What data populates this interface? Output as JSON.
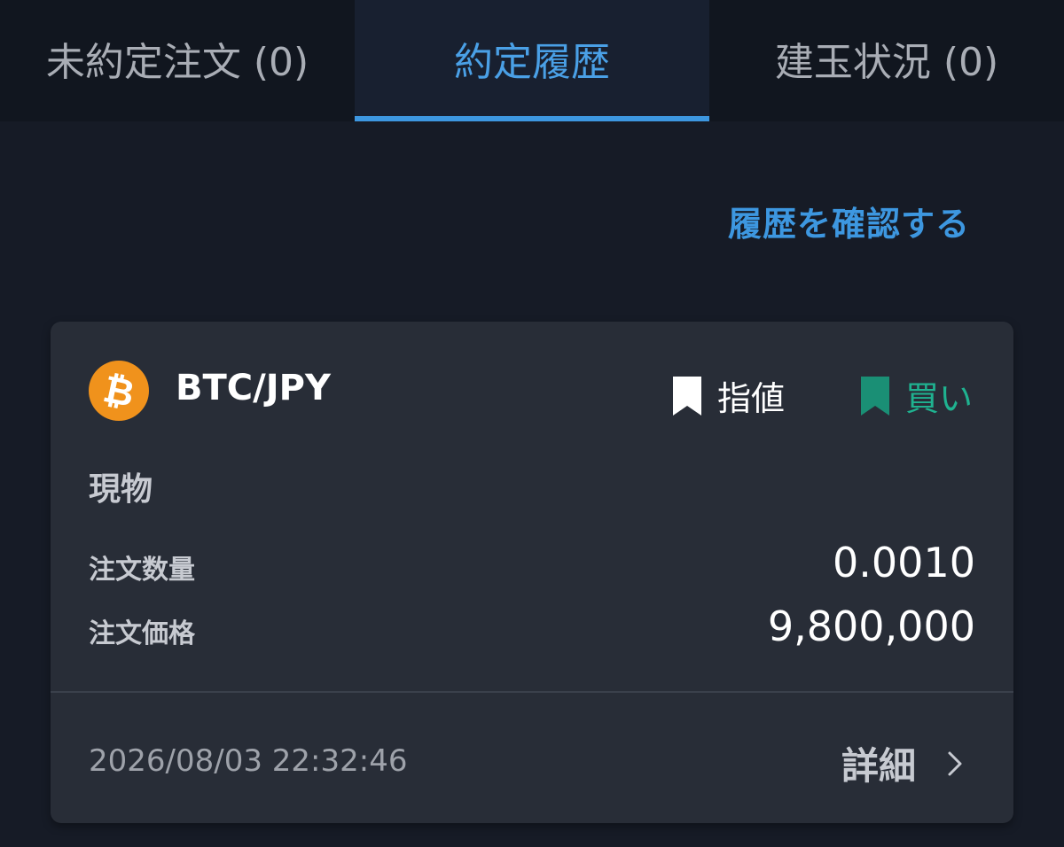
{
  "tabs": [
    {
      "label": "未約定注文 (0)",
      "active": false
    },
    {
      "label": "約定履歴",
      "active": true
    },
    {
      "label": "建玉状況 (0)",
      "active": false
    }
  ],
  "history_link": "履歴を確認する",
  "trade": {
    "coin_icon": "bitcoin-icon",
    "coin_symbol": "₿",
    "pair": "BTC/JPY",
    "order_type": "指値",
    "side": "買い",
    "category": "現物",
    "rows": [
      {
        "label": "注文数量",
        "value": "0.0010"
      },
      {
        "label": "注文価格",
        "value": "9,800,000"
      }
    ],
    "timestamp": "2026/08/03 22:32:46",
    "detail_label": "詳細"
  },
  "colors": {
    "accent": "#3d97e0",
    "buy": "#1fb290",
    "bitcoin": "#f0921c",
    "background": "#161b26",
    "card": "#282d37"
  },
  "icons": {
    "order_type": "bookmark-icon",
    "side": "bookmark-icon",
    "detail": "chevron-right-icon"
  }
}
